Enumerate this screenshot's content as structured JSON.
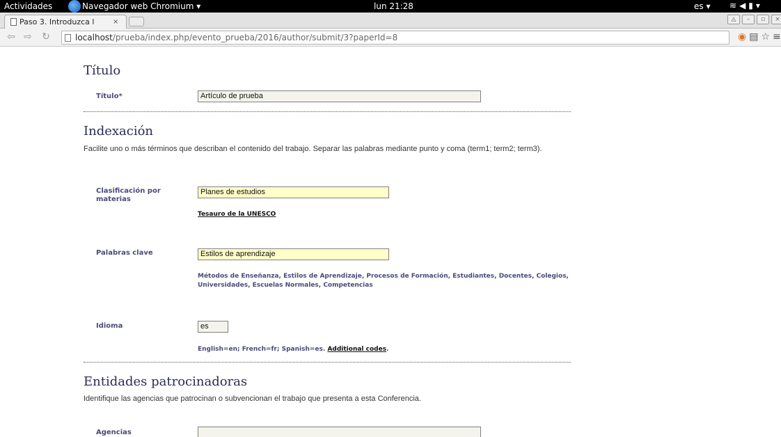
{
  "topbar": {
    "activities": "Actividades",
    "app_name": "Navegador web Chromium ▾",
    "clock": "lun 21:28",
    "language": "es ▾"
  },
  "browser": {
    "tab_title": "Paso 3. Introduzca l",
    "tab_close": "×",
    "url_host": "localhost",
    "url_path": "/prueba/index.php/evento_prueba/2016/author/submit/3?paperId=8"
  },
  "title_section": {
    "heading": "Título",
    "label": "Título*",
    "value": "Artículo de prueba"
  },
  "indexing_section": {
    "heading": "Indexación",
    "description": "Facilite uno o más términos que describan el contenido del trabajo. Separar las palabras mediante punto y coma (term1; term2; term3).",
    "subject_label": "Clasificación por materias",
    "subject_value": "Planes de estudios",
    "subject_link": "Tesauro de la UNESCO",
    "keywords_label": "Palabras clave",
    "keywords_value": "Estilos de aprendizaje",
    "keywords_hint": "Métodos de Enseñanza, Estilos de Aprendizaje, Procesos de Formación, Estudiantes, Docentes, Colegios, Universidades, Escuelas Normales, Competencias",
    "language_label": "Idioma",
    "language_value": "es",
    "language_hint": "English=en; French=fr; Spanish=es.",
    "language_link": "Additional codes",
    "language_hint_end": "."
  },
  "sponsors_section": {
    "heading": "Entidades patrocinadoras",
    "description": "Identifique las agencias que patrocinan o subvencionan el trabajo que presenta a esta Conferencia.",
    "agencies_label": "Agencias",
    "agencies_value": ""
  }
}
